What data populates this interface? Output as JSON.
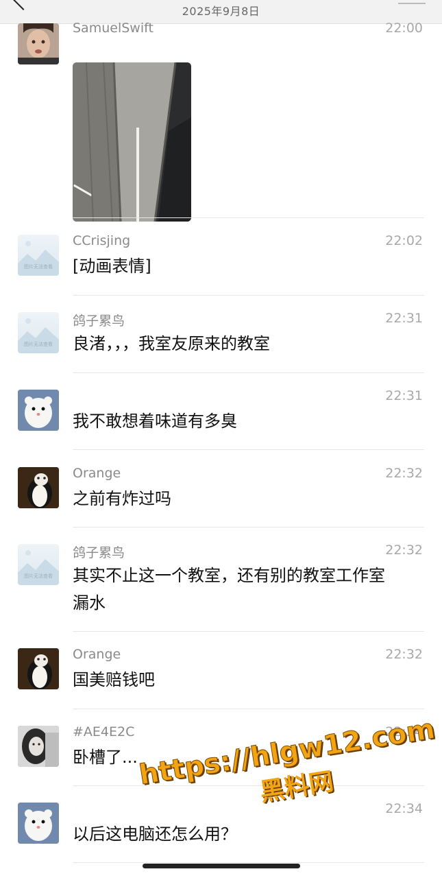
{
  "header": {
    "date": "2025年9月8日"
  },
  "messages": [
    {
      "sender": "SamuelSwift",
      "time": "22:00",
      "text": "",
      "avatar": "person-photo",
      "has_image": true
    },
    {
      "sender": "CCrisjing",
      "time": "22:02",
      "text": "[动画表情]",
      "avatar": "placeholder-image"
    },
    {
      "sender": "鸽子累鸟",
      "time": "22:31",
      "text": "良渚，，，我室友原来的教室",
      "avatar": "placeholder-image"
    },
    {
      "sender": "",
      "time": "22:31",
      "text": "我不敢想着味道有多臭",
      "avatar": "white-ferret"
    },
    {
      "sender": "Orange",
      "time": "22:32",
      "text": "之前有炸过吗",
      "avatar": "cat"
    },
    {
      "sender": "鸽子累鸟",
      "time": "22:32",
      "text_lines": [
        "其实不止这一个教室，还有别的教室工作室",
        "漏水"
      ],
      "avatar": "placeholder-image"
    },
    {
      "sender": "Orange",
      "time": "22:32",
      "text": "国美赔钱吧",
      "avatar": "cat"
    },
    {
      "sender": "#AE4E2C",
      "time": "22:34",
      "text": "卧槽了...",
      "avatar": "girl-bw"
    },
    {
      "sender": "",
      "time": "22:34",
      "text": "以后这电脑还怎么用？",
      "avatar": "white-ferret"
    }
  ],
  "placeholder_caption": "图片无法查看",
  "watermark": {
    "url": "https://hlgw12.com",
    "name": "黑料网"
  },
  "colors": {
    "watermark": "#f2a413",
    "sender": "#8a8a8a",
    "time": "#a8a8a8"
  }
}
